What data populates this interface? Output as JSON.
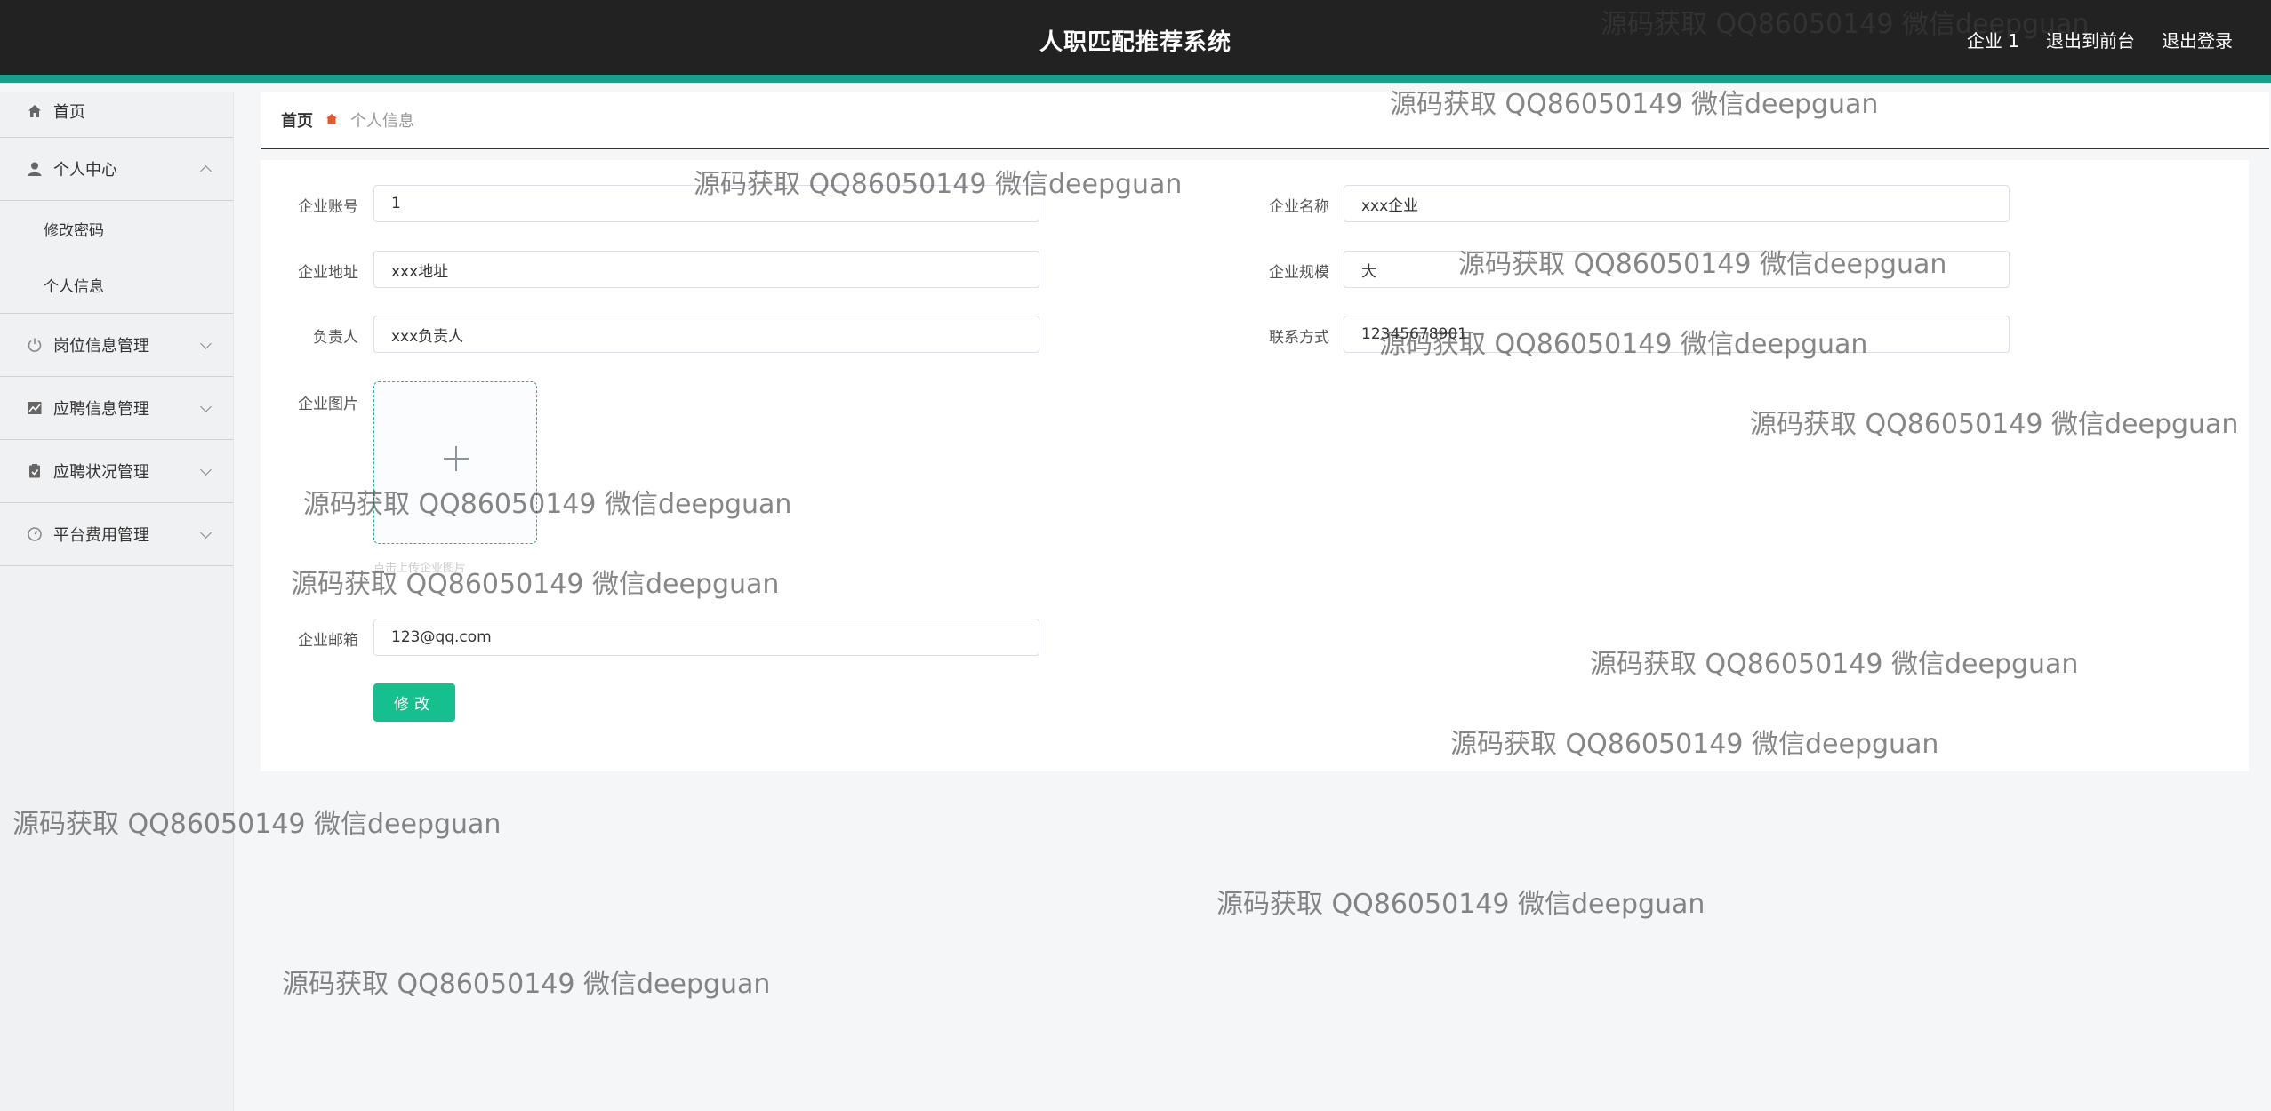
{
  "header": {
    "title": "人职匹配推荐系统",
    "user": "企业 1",
    "back_to_front": "退出到前台",
    "logout": "退出登录"
  },
  "sidebar": {
    "home": "首页",
    "personal_center": "个人中心",
    "change_password": "修改密码",
    "personal_info": "个人信息",
    "job_management": "岗位信息管理",
    "application_management": "应聘信息管理",
    "status_management": "应聘状况管理",
    "fee_management": "平台费用管理"
  },
  "breadcrumb": {
    "home": "首页",
    "current": "个人信息"
  },
  "form": {
    "account_label": "企业账号",
    "account_value": "1",
    "name_label": "企业名称",
    "name_value": "xxx企业",
    "address_label": "企业地址",
    "address_value": "xxx地址",
    "scale_label": "企业规模",
    "scale_value": "大",
    "contact_person_label": "负责人",
    "contact_person_value": "xxx负责人",
    "phone_label": "联系方式",
    "phone_value": "12345678901",
    "image_label": "企业图片",
    "upload_tip": "点击上传企业图片",
    "email_label": "企业邮箱",
    "email_value": "123@qq.com",
    "submit_label": "修改"
  },
  "watermark": "源码获取 QQ86050149 微信deepguan"
}
